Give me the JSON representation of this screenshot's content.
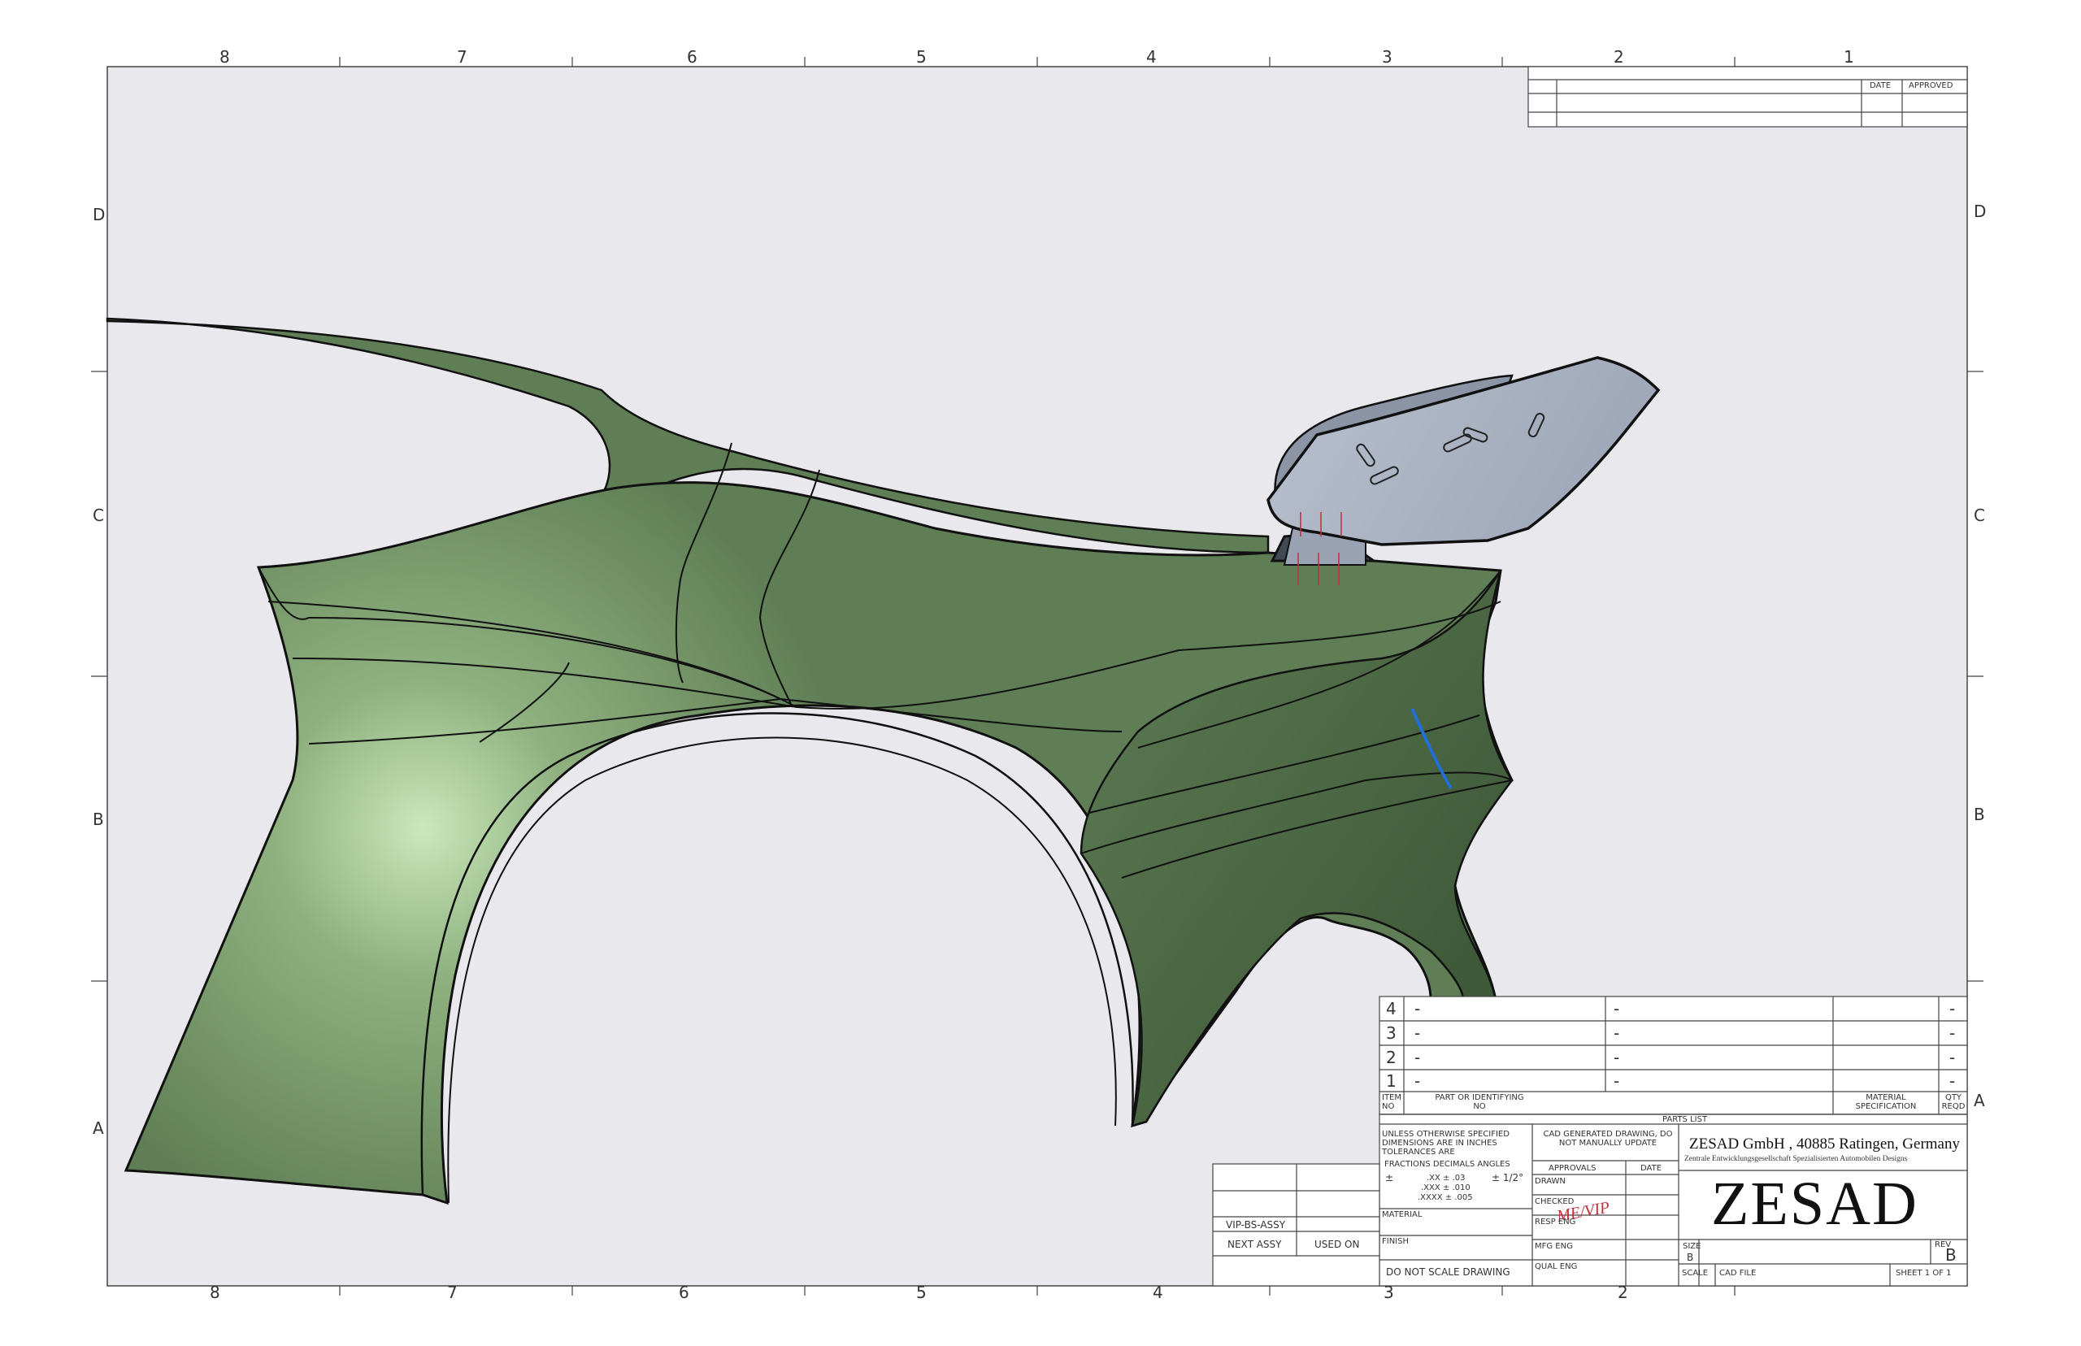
{
  "drawing": {
    "zones_top": [
      "8",
      "7",
      "6",
      "5",
      "4",
      "3",
      "2",
      "1"
    ],
    "zones_bottom": [
      "8",
      "7",
      "6",
      "5",
      "4",
      "3",
      "2"
    ],
    "zones_side": [
      "D",
      "C",
      "B",
      "A"
    ],
    "revision_block": {
      "date_header": "DATE",
      "approved_header": "APPROVED"
    },
    "parts_list": {
      "rows": [
        {
          "item": "4",
          "part": "-",
          "desc": "-",
          "qty": "-"
        },
        {
          "item": "3",
          "part": "-",
          "desc": "-",
          "qty": "-"
        },
        {
          "item": "2",
          "part": "-",
          "desc": "-",
          "qty": "-"
        },
        {
          "item": "1",
          "part": "-",
          "desc": "-",
          "qty": "-"
        }
      ],
      "header_item": "ITEM NO",
      "header_part": "PART OR IDENTIFYING NO",
      "header_material": "MATERIAL SPECIFICATION",
      "header_qty": "QTY REQD",
      "title": "PARTS LIST"
    },
    "title_block": {
      "tolerance_note": "UNLESS OTHERWISE SPECIFIED DIMENSIONS ARE IN INCHES TOLERANCES ARE",
      "fractions_label": "FRACTIONS  DECIMALS  ANGLES",
      "plusminus": "±",
      "tol_xx": ".XX  ±  .03",
      "tol_xxx": ".XXX  ±  .010",
      "tol_xxxx": ".XXXX  ±  .005",
      "tol_angle": "±  1/2°",
      "material_label": "MATERIAL",
      "finish_label": "FINISH",
      "do_not_scale": "DO NOT SCALE DRAWING",
      "cad_note": "CAD GENERATED DRAWING, DO NOT MANUALLY UPDATE",
      "approvals_label": "APPROVALS",
      "date_label": "DATE",
      "drawn_label": "DRAWN",
      "checked_label": "CHECKED",
      "resp_eng_label": "RESP ENG",
      "mfg_eng_label": "MFG ENG",
      "qual_eng_label": "QUAL ENG",
      "signature": "ME/VIP",
      "company": "ZESAD GmbH , 40885 Ratingen, Germany",
      "company_sub": "Zentrale Entwicklungsgesellschaft Spezialisierten Automobilen Designs",
      "logo": "ZESAD",
      "size_label": "SIZE",
      "size_value": "B",
      "rev_label": "REV",
      "rev_value": "B",
      "scale_label": "SCALE",
      "cad_file_label": "CAD FILE",
      "sheet_label": "SHEET 1 OF 1"
    },
    "application_block": {
      "assy": "VIP-BS-ASSY",
      "next_assy": "NEXT ASSY",
      "used_on": "USED ON"
    },
    "colors": {
      "sheet": "#e9e9ed",
      "panel_green": "#5f7e55",
      "panel_highlight": "#c9e8bc",
      "bracket_gray": "#a7afbf",
      "accent_blue": "#1f6fd6",
      "accent_red": "#c0303a"
    }
  }
}
